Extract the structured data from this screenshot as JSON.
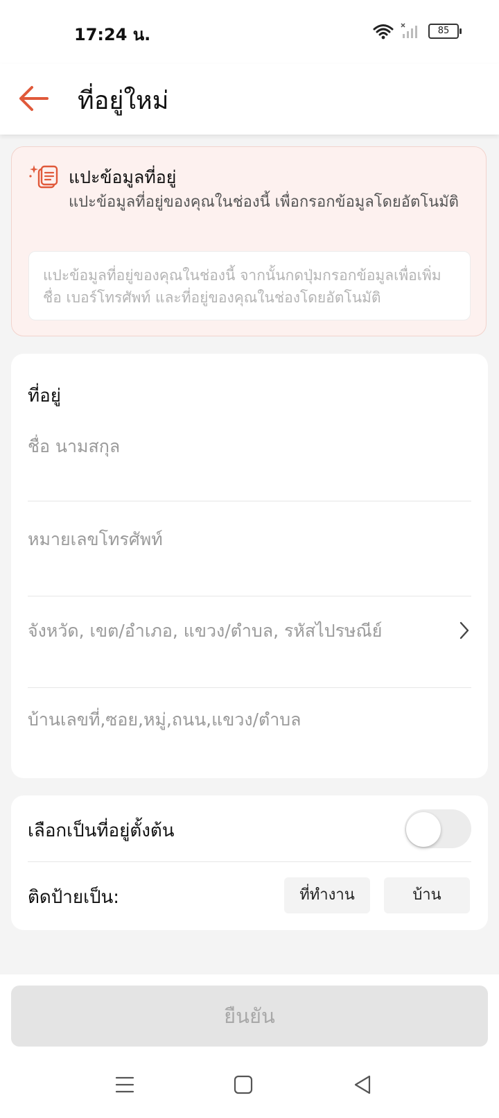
{
  "status_bar": {
    "time": "17:24 น.",
    "battery": "85"
  },
  "header": {
    "title": "ที่อยู่ใหม่"
  },
  "paste_section": {
    "title": "แปะข้อมูลที่อยู่",
    "description": "แปะข้อมูลที่อยู่ของคุณในช่องนี้ เพื่อกรอกข้อมูลโดยอัตโนมัติ",
    "input_placeholder": "แปะข้อมูลที่อยู่ของคุณในช่องนี้ จากนั้นกดปุ่มกรอกข้อมูลเพื่อเพิ่มชื่อ เบอร์โทรศัพท์ และที่อยู่ของคุณในช่องโดยอัตโนมัติ"
  },
  "address_form": {
    "section_label": "ที่อยู่",
    "name_placeholder": "ชื่อ นามสกุล",
    "phone_placeholder": "หมายเลขโทรศัพท์",
    "region_placeholder": "จังหวัด, เขต/อำเภอ, แขวง/ตำบล, รหัสไปรษณีย์",
    "street_placeholder": "บ้านเลขที่,ซอย,หมู่,ถนน,แขวง/ตำบล"
  },
  "default_section": {
    "default_label": "เลือกเป็นที่อยู่ตั้งต้น",
    "default_enabled": false,
    "tag_label": "ติดป้ายเป็น:",
    "tag_work": "ที่ทำงาน",
    "tag_home": "บ้าน"
  },
  "footer": {
    "confirm_label": "ยืนยัน"
  },
  "colors": {
    "accent": "#e0593a",
    "paste_bg": "#fdf1ef",
    "disabled_button": "#e4e4e4"
  },
  "icons": {
    "back": "arrow-left-icon",
    "paste": "paste-sparkle-icon",
    "chevron": "chevron-right-icon",
    "nav_menu": "menu-icon",
    "nav_home": "home-square-icon",
    "nav_back": "back-triangle-icon"
  }
}
